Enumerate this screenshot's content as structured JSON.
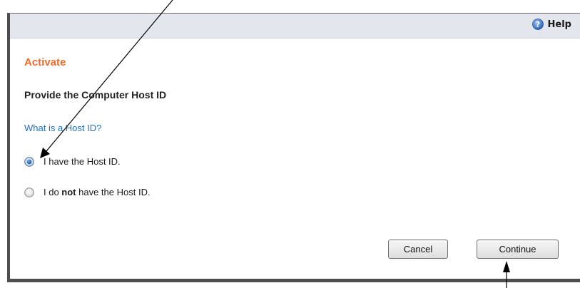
{
  "header": {
    "help_label": "Help",
    "help_icon": "help-circle-icon"
  },
  "main": {
    "section_title": "Activate",
    "heading": "Provide the Computer Host ID",
    "link_text": "What is a Host ID?"
  },
  "options": [
    {
      "label_pre": "I have the Host ID.",
      "label_bold": "",
      "label_post": "",
      "selected": true
    },
    {
      "label_pre": "I do ",
      "label_bold": "not",
      "label_post": " have the Host ID.",
      "selected": false
    }
  ],
  "buttons": {
    "cancel": "Cancel",
    "continue": "Continue"
  },
  "colors": {
    "accent_orange": "#f26b2b",
    "link_blue": "#1a70c8",
    "header_bar": "#e4e6ee",
    "frame": "#4e4e4e"
  }
}
